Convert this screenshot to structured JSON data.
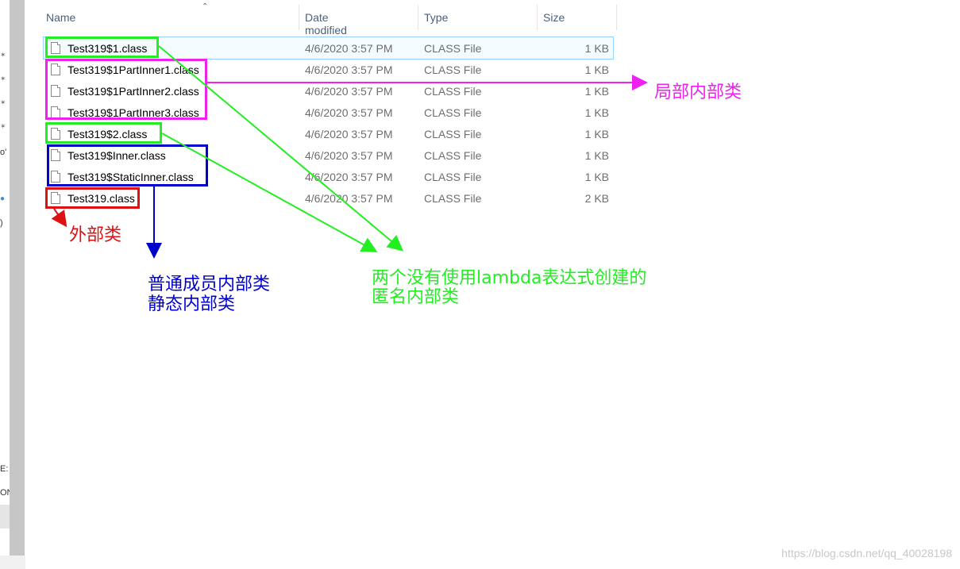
{
  "columns": {
    "name": "Name",
    "date": "Date modified",
    "type": "Type",
    "size": "Size"
  },
  "files": [
    {
      "name": "Test319$1.class",
      "date": "4/6/2020 3:57 PM",
      "type": "CLASS File",
      "size": "1 KB"
    },
    {
      "name": "Test319$1PartInner1.class",
      "date": "4/6/2020 3:57 PM",
      "type": "CLASS File",
      "size": "1 KB"
    },
    {
      "name": "Test319$1PartInner2.class",
      "date": "4/6/2020 3:57 PM",
      "type": "CLASS File",
      "size": "1 KB"
    },
    {
      "name": "Test319$1PartInner3.class",
      "date": "4/6/2020 3:57 PM",
      "type": "CLASS File",
      "size": "1 KB"
    },
    {
      "name": "Test319$2.class",
      "date": "4/6/2020 3:57 PM",
      "type": "CLASS File",
      "size": "1 KB"
    },
    {
      "name": "Test319$Inner.class",
      "date": "4/6/2020 3:57 PM",
      "type": "CLASS File",
      "size": "1 KB"
    },
    {
      "name": "Test319$StaticInner.class",
      "date": "4/6/2020 3:57 PM",
      "type": "CLASS File",
      "size": "1 KB"
    },
    {
      "name": "Test319.class",
      "date": "4/6/2020 3:57 PM",
      "type": "CLASS File",
      "size": "2 KB"
    }
  ],
  "annotations": {
    "local": "局部内部类",
    "outer": "外部类",
    "member_line1": "普通成员内部类",
    "member_line2": "静态内部类",
    "anon_line1": "两个没有使用lambda表达式创建的",
    "anon_line2": "匿名内部类"
  },
  "nav_fragments": {
    "a": "o'",
    "b": ")",
    "c": "E:",
    "d": "ON"
  },
  "watermark": "https://blog.csdn.net/qq_40028198",
  "colors": {
    "green": "#22ee22",
    "magenta": "#ee22ee",
    "blue": "#0000cc",
    "red": "#dd1111",
    "selected_row": "#99d1ff"
  }
}
